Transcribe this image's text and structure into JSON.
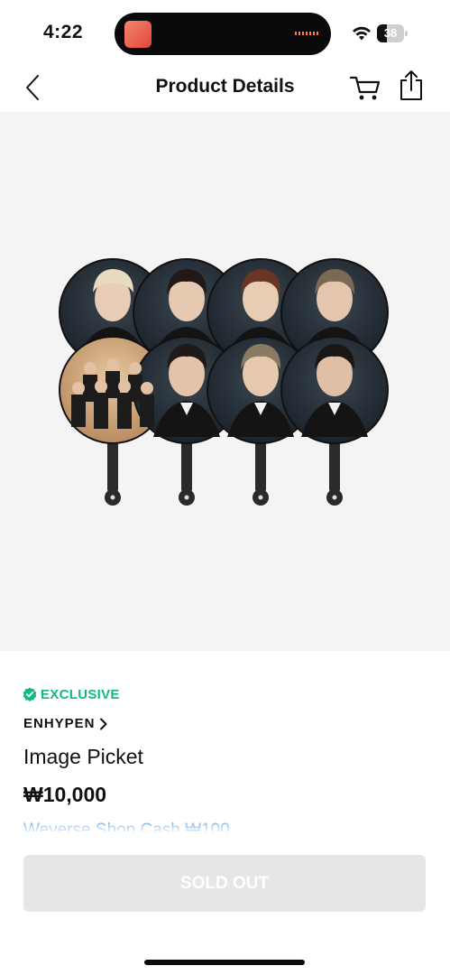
{
  "status_bar": {
    "time": "4:22",
    "battery_level": "38",
    "battery_fraction": 0.38,
    "island_accent": "#ff7a3c"
  },
  "header": {
    "title": "Product Details",
    "back_icon": "chevron-left-icon",
    "cart_icon": "cart-icon",
    "share_icon": "share-icon"
  },
  "product": {
    "image_description_icon": "image-picket-fans",
    "badge": "EXCLUSIVE",
    "badge_color": "#12b886",
    "artist": "ENHYPEN",
    "name": "Image Picket",
    "price": "₩10,000",
    "cash": "Weverse Shop Cash ₩100",
    "cash_color": "#3f8fd8"
  },
  "action": {
    "button_label": "SOLD OUT",
    "button_color": "#e6e6e9"
  }
}
